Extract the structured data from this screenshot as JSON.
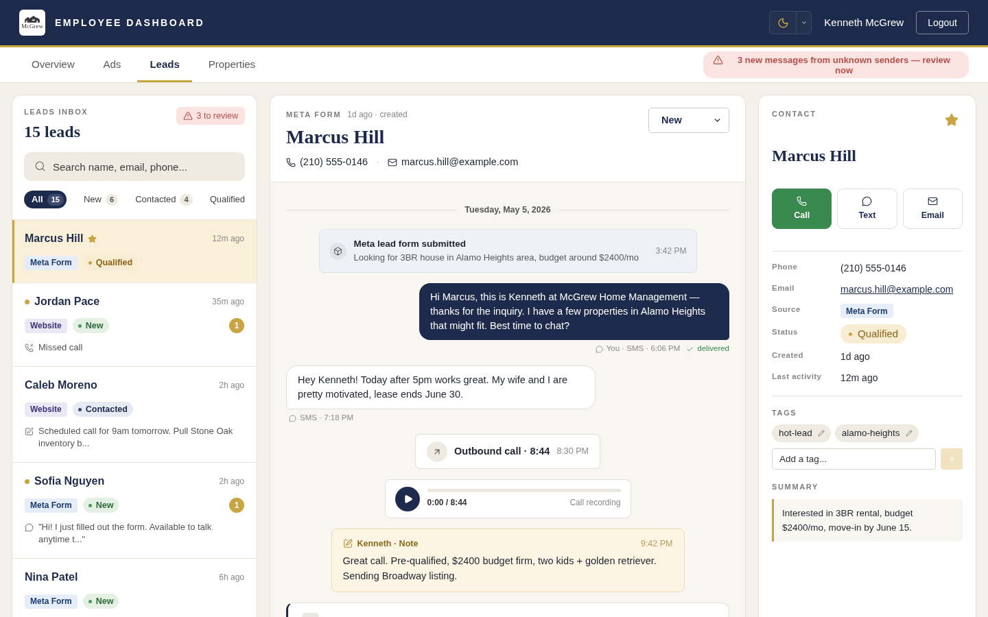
{
  "header": {
    "logo_text": "McGrew",
    "title": "EMPLOYEE DASHBOARD",
    "dark_mode": false,
    "user": "Kenneth McGrew",
    "logout": "Logout"
  },
  "tabs": [
    {
      "label": "Overview",
      "selected": false
    },
    {
      "label": "Ads",
      "selected": false
    },
    {
      "label": "Leads",
      "selected": true
    },
    {
      "label": "Properties",
      "selected": false
    }
  ],
  "alert": {
    "text": "3 new messages from unknown senders — review now"
  },
  "inbox": {
    "eyebrow": "LEADS INBOX",
    "count": "15 leads",
    "review": "3 to review",
    "search": {
      "placeholder": "Search name, email, phone..."
    },
    "filters": [
      {
        "label": "All",
        "count": "15",
        "selected": true
      },
      {
        "label": "New",
        "count": "6",
        "selected": false
      },
      {
        "label": "Contacted",
        "count": "4",
        "selected": false
      },
      {
        "label": "Qualified",
        "selected": false
      }
    ],
    "leads": [
      {
        "name": "Marcus Hill",
        "time": "12m ago",
        "selected": true,
        "starred": true,
        "unread": false,
        "source": {
          "label": "Meta Form",
          "kind": "meta"
        },
        "status": {
          "label": "Qualified",
          "kind": "qualified"
        }
      },
      {
        "name": "Jordan Pace",
        "time": "35m ago",
        "selected": false,
        "starred": false,
        "unread": true,
        "source": {
          "label": "Website",
          "kind": "website"
        },
        "status": {
          "label": "New",
          "kind": "new"
        },
        "badge": "1",
        "activity": {
          "kind": "missed_call",
          "text": "Missed call"
        }
      },
      {
        "name": "Caleb Moreno",
        "time": "2h ago",
        "selected": false,
        "starred": false,
        "unread": false,
        "source": {
          "label": "Website",
          "kind": "website"
        },
        "status": {
          "label": "Contacted",
          "kind": "contacted"
        },
        "activity": {
          "kind": "note",
          "text": "Scheduled call for 9am tomorrow. Pull Stone Oak inventory b..."
        }
      },
      {
        "name": "Sofia Nguyen",
        "time": "2h ago",
        "selected": false,
        "starred": false,
        "unread": true,
        "source": {
          "label": "Meta Form",
          "kind": "meta"
        },
        "status": {
          "label": "New",
          "kind": "new"
        },
        "badge": "1",
        "activity": {
          "kind": "message",
          "text": "\"Hi! I just filled out the form. Available to talk anytime t...\""
        }
      },
      {
        "name": "Nina Patel",
        "time": "6h ago",
        "selected": false,
        "starred": false,
        "unread": false,
        "source": {
          "label": "Meta Form",
          "kind": "meta"
        },
        "status": {
          "label": "New",
          "kind": "new"
        }
      }
    ]
  },
  "conversation": {
    "source": "META FORM",
    "created": "1d ago · created",
    "name": "Marcus Hill",
    "status_select": "New",
    "phone": "(210) 555-0146",
    "separator": "·",
    "email": "marcus.hill@example.com",
    "date": "Tuesday, May 5, 2026",
    "events": [
      {
        "kind": "form",
        "title": "Meta lead form submitted",
        "text": "Looking for 3BR house in Alamo Heights area, budget around $2400/mo",
        "time": "3:42 PM"
      },
      {
        "kind": "outgoing",
        "text": "Hi Marcus, this is Kenneth at McGrew Home Management — thanks for the inquiry. I have a few properties in Alamo Heights that might fit. Best time to chat?",
        "meta": "You · SMS · 6:06 PM",
        "status": "delivered"
      },
      {
        "kind": "incoming",
        "text": "Hey Kenneth! Today after 5pm works great. My wife and I are pretty motivated, lease ends June 30.",
        "meta": "SMS · 7:18 PM"
      },
      {
        "kind": "call",
        "title": "Outbound call · 8:44",
        "time": "8:30 PM"
      },
      {
        "kind": "recording",
        "time": "0:00 / 8:44",
        "label": "Call recording",
        "level": 0
      },
      {
        "kind": "note",
        "author": "Kenneth · Note",
        "time": "9:42 PM",
        "text": "Great call. Pre-qualified, $2400 budget firm, two kids + golden retriever. Sending Broadway listing."
      },
      {
        "kind": "partial"
      }
    ]
  },
  "contact": {
    "eyebrow": "CONTACT",
    "starred": true,
    "name": "Marcus Hill",
    "actions": [
      {
        "label": "Call",
        "kind": "call"
      },
      {
        "label": "Text",
        "kind": "text"
      },
      {
        "label": "Email",
        "kind": "email"
      }
    ],
    "fields": [
      {
        "label": "Phone",
        "kind": "text",
        "value": "(210) 555-0146"
      },
      {
        "label": "Email",
        "kind": "link",
        "value": "marcus.hill@example.com"
      },
      {
        "label": "Source",
        "kind": "source",
        "value": "Meta Form"
      },
      {
        "label": "Status",
        "kind": "status",
        "value": "Qualified"
      },
      {
        "label": "Created",
        "kind": "text",
        "value": "1d ago"
      },
      {
        "label": "Last activity",
        "kind": "text",
        "value": "12m ago"
      }
    ],
    "tags_heading": "TAGS",
    "tags": [
      "hot-lead",
      "alamo-heights"
    ],
    "tag_input": {
      "placeholder": "Add a tag...",
      "add_disabled": true
    },
    "summary_heading": "SUMMARY",
    "summary": "Interested in 3BR rental, budget $2400/mo, move-in by June 15."
  }
}
